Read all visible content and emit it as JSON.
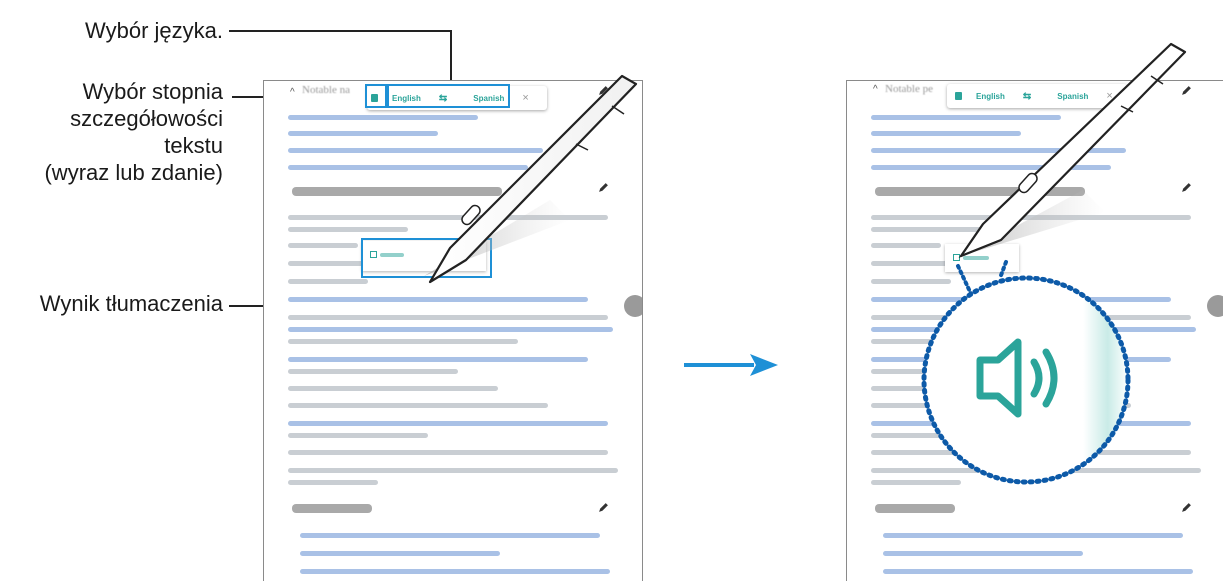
{
  "callouts": {
    "language": "Wybór języka.",
    "detail_line1": "Wybór stopnia",
    "detail_line2": "szczegółowości",
    "detail_line3": "tekstu",
    "detail_line4": "(wyraz lub zdanie)",
    "result": "Wynik tłumaczenia"
  },
  "left_screen": {
    "heading": "Notable na",
    "toolbar": {
      "mode_icon": "text-mode-icon",
      "source": "English",
      "swap_icon": "swap-arrows-icon",
      "target": "Spanish",
      "close": "×"
    }
  },
  "right_screen": {
    "heading": "Notable pe",
    "toolbar": {
      "mode_icon": "text-mode-icon",
      "source": "English",
      "swap_icon": "swap-arrows-icon",
      "target": "Spanish",
      "close": "×"
    }
  },
  "colors": {
    "accent": "#1e90d6",
    "teal": "#2ba49a",
    "arrow": "#1e90d6"
  }
}
